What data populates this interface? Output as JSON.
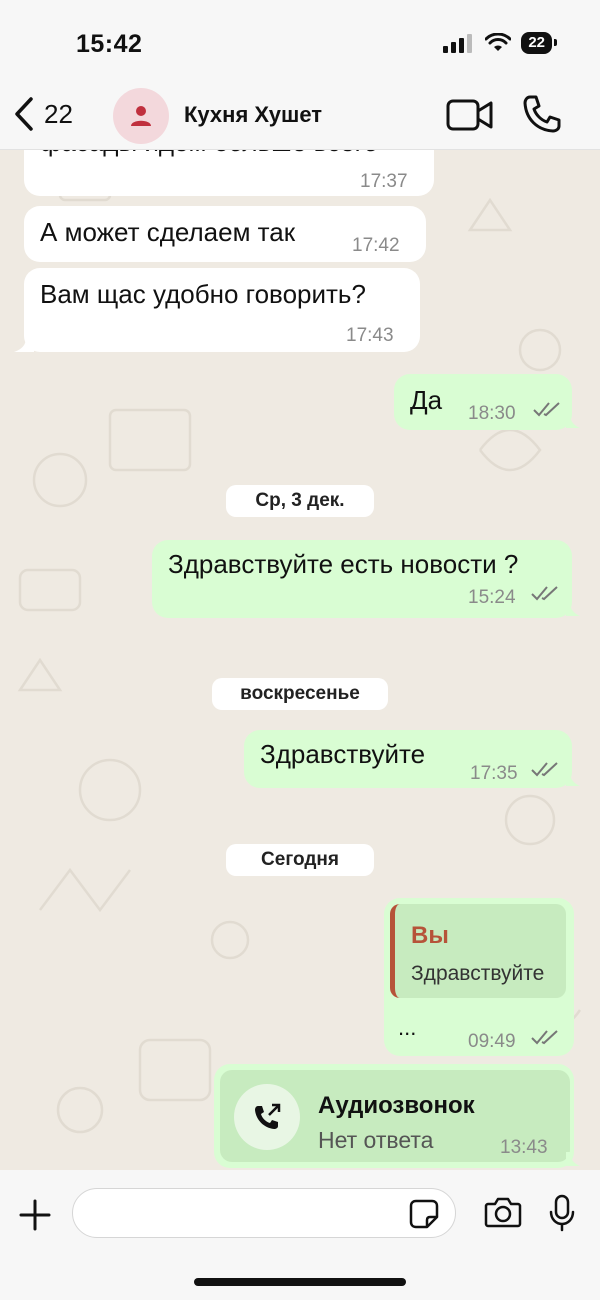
{
  "status_bar": {
    "time": "15:42",
    "battery": "22"
  },
  "header": {
    "back_count": "22",
    "contact_name": "Кухня Хушет"
  },
  "messages": [
    {
      "text": "фасады идем больше всего",
      "time": "17:37"
    },
    {
      "text": "А может сделаем так",
      "time": "17:42"
    },
    {
      "text": "Вам щас удобно говорить?",
      "time": "17:43"
    },
    {
      "text": "Да",
      "time": "18:30"
    },
    {
      "text": "Здравствуйте есть новости ?",
      "time": "15:24"
    },
    {
      "text": "Здравствуйте",
      "time": "17:35"
    },
    {
      "text": "...",
      "time": "09:49",
      "quote_author": "Вы",
      "quote_text": "Здравствуйте"
    }
  ],
  "date_chips": [
    "Ср, 3 дек.",
    "воскресенье",
    "Сегодня"
  ],
  "call": {
    "title": "Аудиозвонок",
    "subtitle": "Нет ответа",
    "time": "13:43"
  },
  "input": {
    "placeholder": ""
  },
  "colors": {
    "outgoing": "#d9fdd3",
    "incoming": "#ffffff",
    "background": "#efeae2",
    "quote_accent": "#b65339"
  },
  "icons": [
    "back-chevron-icon",
    "person-icon",
    "video-call-icon",
    "phone-icon",
    "double-check-icon",
    "plus-icon",
    "sticker-icon",
    "camera-icon",
    "microphone-icon",
    "outgoing-call-icon"
  ]
}
